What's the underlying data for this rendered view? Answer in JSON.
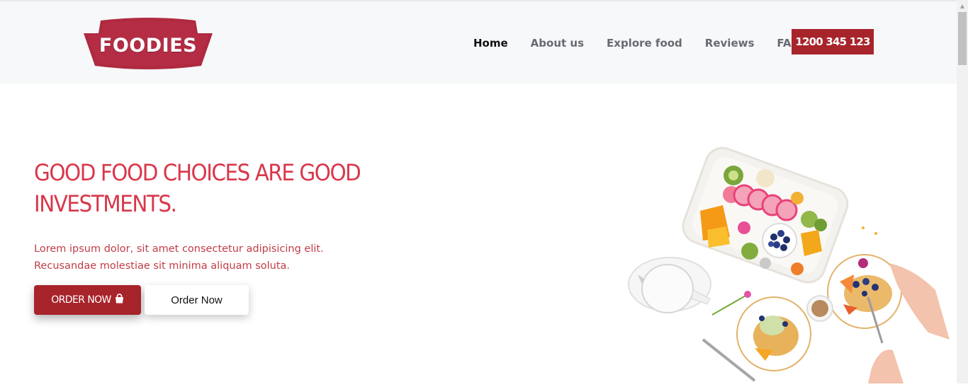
{
  "brand": {
    "logo_text": "FOODIES",
    "color": "#a8242b"
  },
  "nav": {
    "items": [
      {
        "label": "Home",
        "active": true
      },
      {
        "label": "About us",
        "active": false
      },
      {
        "label": "Explore food",
        "active": false
      },
      {
        "label": "Reviews",
        "active": false
      },
      {
        "label": "FAQ",
        "active": false
      }
    ],
    "phone": "1200 345 123"
  },
  "hero": {
    "title": "GOOD FOOD CHOICES ARE GOOD INVESTMENTS.",
    "text": "Lorem ipsum dolor, sit amet consectetur adipisicing elit. Recusandae molestiae sit minima aliquam soluta.",
    "primary_button": "ORDER NOW",
    "primary_button_icon": "shopping-bag-icon",
    "secondary_button": "Order Now",
    "title_color": "#d9374b",
    "text_color": "#c23c46"
  },
  "image": {
    "subject": "food-platter-icon"
  }
}
